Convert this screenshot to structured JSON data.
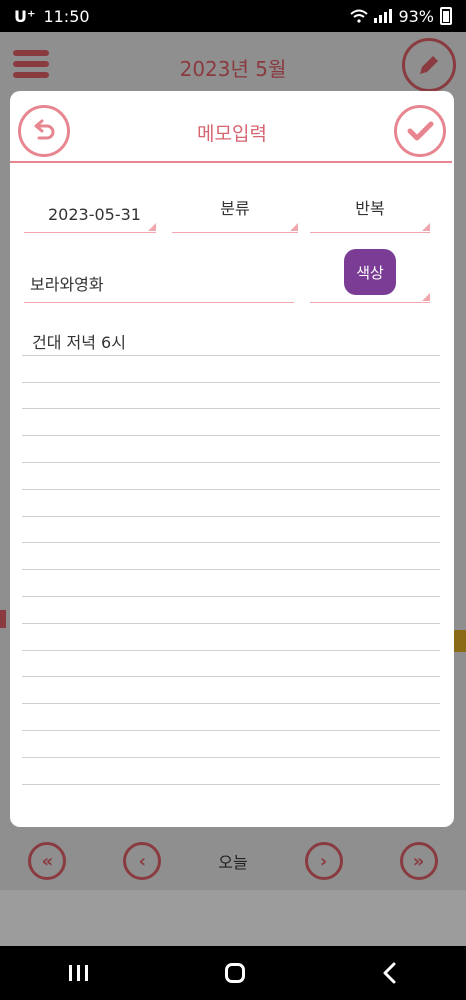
{
  "status_bar": {
    "carrier": "U⁺",
    "time": "11:50",
    "battery": "93%"
  },
  "background": {
    "month_title": "2023년 5월",
    "today_label": "오늘"
  },
  "modal": {
    "title": "메모입력",
    "date": "2023-05-31",
    "category_label": "분류",
    "repeat_label": "반복",
    "title_value": "보라와영화",
    "color_label": "색상",
    "color": "#7b3c95",
    "memo_lines": [
      "건대 저녁 6시",
      "",
      "",
      "",
      "",
      "",
      "",
      "",
      "",
      "",
      "",
      "",
      "",
      "",
      "",
      "",
      ""
    ]
  },
  "colors": {
    "accent": "#e78690",
    "title_text": "#d56672"
  }
}
